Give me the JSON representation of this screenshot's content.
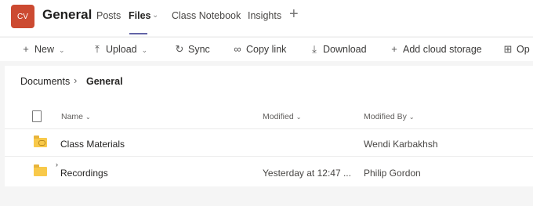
{
  "accent": "#cc4a31",
  "team": {
    "initials": "CV",
    "name": "General"
  },
  "tabs": [
    {
      "label": "Posts"
    },
    {
      "label": "Files"
    },
    {
      "label": "Class Notebook"
    },
    {
      "label": "Insights"
    }
  ],
  "tab_add_glyph": "+",
  "commands": {
    "new": "New",
    "upload": "Upload",
    "sync": "Sync",
    "copy_link": "Copy link",
    "download": "Download",
    "add_cloud": "Add cloud storage",
    "open_partial": "Op"
  },
  "breadcrumb": {
    "root": "Documents",
    "current": "General"
  },
  "columns": {
    "name": "Name",
    "modified": "Modified",
    "modified_by": "Modified By"
  },
  "rows": [
    {
      "name": "Class Materials",
      "modified": "",
      "modified_by": "Wendi Karbakhsh"
    },
    {
      "name": "Recordings",
      "modified": "Yesterday at 12:47 ...",
      "modified_by": "Philip Gordon"
    }
  ],
  "icons": {
    "new": "plus-icon",
    "upload": "upload-icon",
    "sync": "sync-icon",
    "copy_link": "link-icon",
    "download": "download-icon",
    "add_cloud": "plus-icon",
    "open": "open-icon",
    "file_type": "document-icon",
    "folder": "folder-icon"
  }
}
